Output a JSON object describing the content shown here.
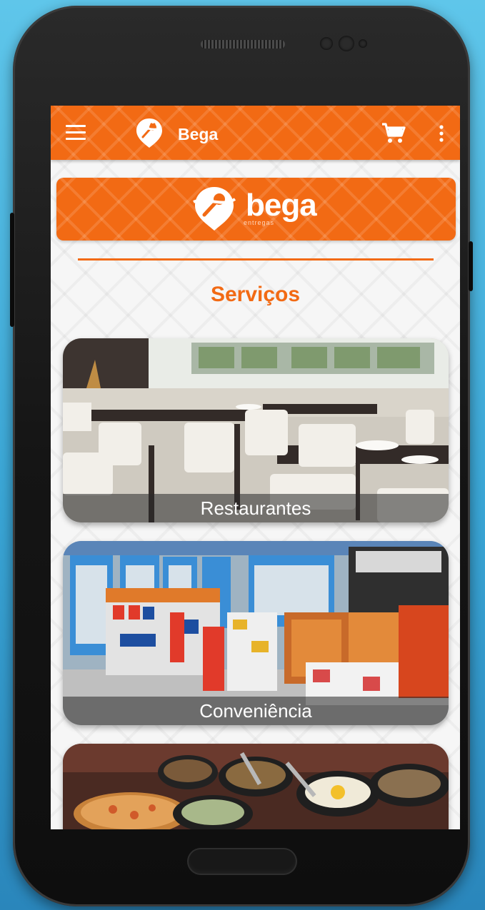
{
  "appbar": {
    "title": "Bega",
    "menu_icon": "hamburger-menu-icon",
    "cart_icon": "shopping-cart-icon",
    "more_icon": "more-vertical-icon"
  },
  "banner": {
    "wordmark": "bega",
    "subtext": "entregas"
  },
  "section": {
    "title": "Serviços"
  },
  "services": [
    {
      "label": "Restaurantes"
    },
    {
      "label": "Conveniência"
    },
    {
      "label": ""
    }
  ],
  "colors": {
    "primary": "#f26a14",
    "background": "#f4f4f4",
    "device_background": "#3aa6d6"
  }
}
